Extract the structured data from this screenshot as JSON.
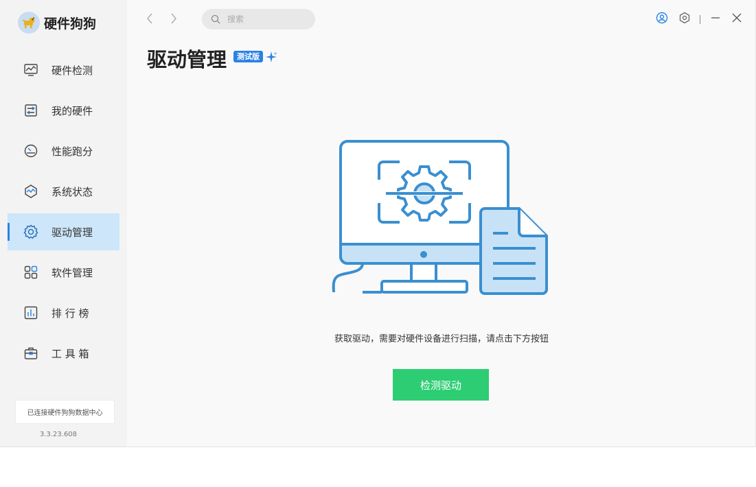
{
  "app": {
    "name": "硬件狗狗",
    "logo_icon": "dog-logo-icon"
  },
  "sidebar": {
    "items": [
      {
        "label": "硬件检测",
        "icon": "monitor-wave-icon",
        "active": false
      },
      {
        "label": "我的硬件",
        "icon": "hardware-chip-icon",
        "active": false
      },
      {
        "label": "性能跑分",
        "icon": "speedometer-icon",
        "active": false
      },
      {
        "label": "系统状态",
        "icon": "system-status-icon",
        "active": false
      },
      {
        "label": "驱动管理",
        "icon": "gear-icon",
        "active": true
      },
      {
        "label": "软件管理",
        "icon": "apps-grid-icon",
        "active": false
      },
      {
        "label": "排 行 榜",
        "icon": "ranking-chart-icon",
        "active": false
      },
      {
        "label": "工 具 箱",
        "icon": "toolbox-icon",
        "active": false
      }
    ],
    "status": "已连接硬件狗狗数据中心",
    "version": "3.3.23.608"
  },
  "topbar": {
    "search_placeholder": "搜索",
    "back_icon": "chevron-left-icon",
    "forward_icon": "chevron-right-icon",
    "user_icon": "user-icon",
    "settings_icon": "settings-icon",
    "minimize_icon": "minimize-icon",
    "close_icon": "close-icon"
  },
  "main": {
    "title": "驱动管理",
    "badge": "测试版",
    "hint": "获取驱动，需要对硬件设备进行扫描，请点击下方按钮",
    "button_label": "检测驱动"
  },
  "colors": {
    "accent": "#2a82e4",
    "button": "#2dcd73",
    "active_bg": "#cde6f9",
    "illustration_stroke": "#3a8fd0",
    "illustration_fill": "#c7e2f6"
  }
}
